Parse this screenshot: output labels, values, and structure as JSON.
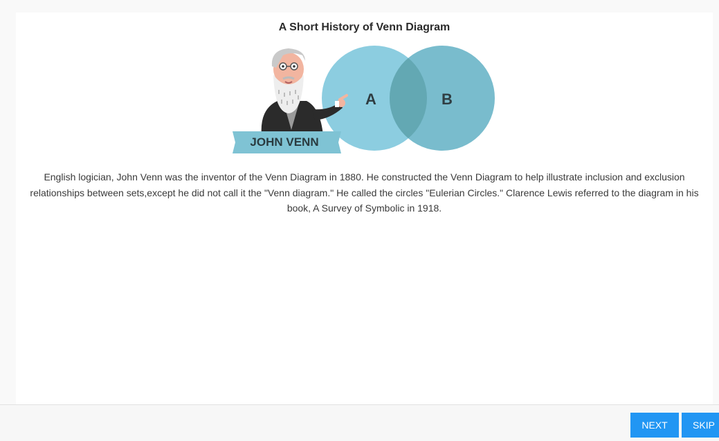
{
  "card": {
    "title": "A Short History of Venn Diagram",
    "illustration": {
      "banner_label": "JOHN VENN",
      "circle_a_label": "A",
      "circle_b_label": "B",
      "colors": {
        "circle_a": "#8ccde0",
        "circle_b": "#79bccd",
        "overlap": "#63a8b3",
        "banner": "#7fc3d4"
      }
    },
    "description": "English logician, John Venn was the inventor of the Venn Diagram in 1880. He constructed the Venn Diagram to help illustrate inclusion and exclusion relationships between sets,except he did not call it the \"Venn diagram.\" He called the circles \"Eulerian Circles.\" Clarence Lewis referred to the diagram in his book, A Survey of Symbolic in 1918."
  },
  "footer": {
    "next_label": "NEXT",
    "skip_label": "SKIP",
    "accent_color": "#2196f3"
  }
}
